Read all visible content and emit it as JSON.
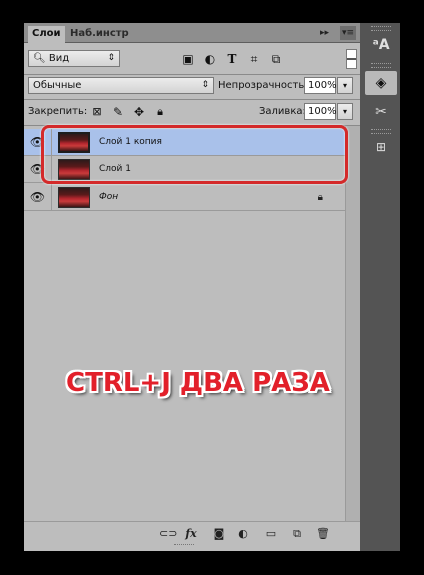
{
  "tabs": [
    "Слои",
    "Наб.инстр"
  ],
  "tab_controls": {
    "collapse": "▸▸",
    "menu": "▾≡"
  },
  "kind_filter": {
    "value": "Вид",
    "icon": "search-icon"
  },
  "filter_icons": [
    "image-icon",
    "adjustment-circle-icon",
    "text-icon",
    "transform-icon",
    "smart-object-icon"
  ],
  "blend_mode": {
    "value": "Обычные"
  },
  "opacity": {
    "label": "Непрозрачность:",
    "value": "100%"
  },
  "lock": {
    "label": "Закрепить:",
    "icons": [
      "lock-transparency-icon",
      "brush-icon",
      "move-icon",
      "lock-icon"
    ]
  },
  "fill": {
    "label": "Заливка:",
    "value": "100%"
  },
  "layers": [
    {
      "name": "Слой 1 копия",
      "selected": true,
      "visible": true,
      "locked": false,
      "italic": false
    },
    {
      "name": "Слой 1",
      "selected": false,
      "visible": true,
      "locked": false,
      "italic": false
    },
    {
      "name": "Фон",
      "selected": false,
      "visible": true,
      "locked": true,
      "italic": true
    }
  ],
  "bottom_icons": [
    "link-icon",
    "fx-icon",
    "mask-icon",
    "adjustment-icon",
    "folder-icon",
    "new-layer-icon",
    "trash-icon"
  ],
  "caption": "CTRL+J ДВА РАЗА",
  "side_buttons": [
    "character-icon",
    "layers-icon",
    "tools-icon",
    "3d-icon"
  ],
  "colors": {
    "selection": "#a9c1ea",
    "highlight": "#d42a2a",
    "caption": "#e2202a"
  }
}
